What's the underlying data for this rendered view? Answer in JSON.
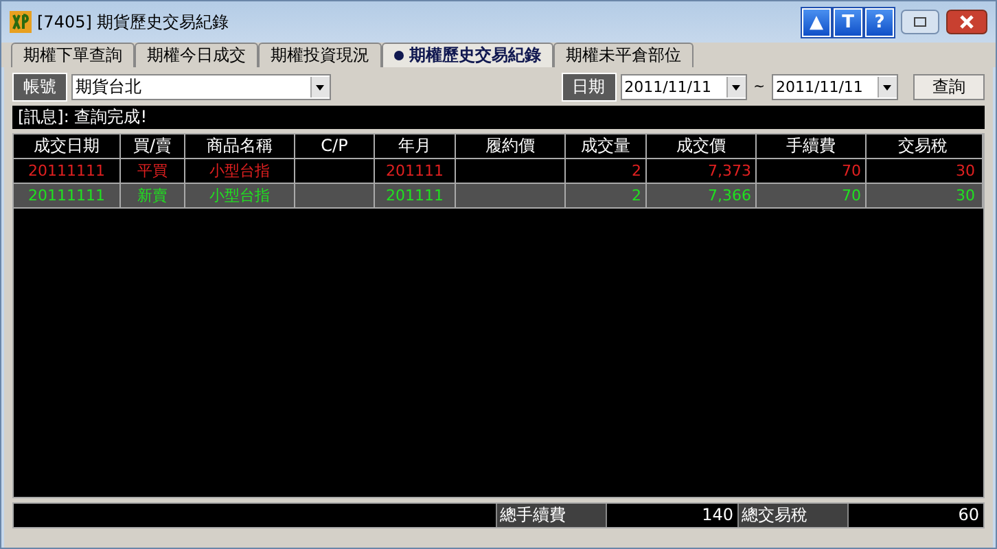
{
  "window": {
    "title": "[7405] 期貨歷史交易紀錄",
    "tool_buttons": [
      "▲",
      "T",
      "?"
    ]
  },
  "tabs": [
    {
      "label": "期權下單查詢",
      "selected": false
    },
    {
      "label": "期權今日成交",
      "selected": false
    },
    {
      "label": "期權投資現況",
      "selected": false
    },
    {
      "label": "期權歷史交易紀錄",
      "selected": true
    },
    {
      "label": "期權未平倉部位",
      "selected": false
    }
  ],
  "toolbar": {
    "account_label": "帳號",
    "account": "期貨台北",
    "date_label": "日期",
    "date_from": "2011/11/11",
    "separator": "~",
    "date_to": "2011/11/11",
    "query_button": "查詢"
  },
  "message": "[訊息]: 查詢完成!",
  "table": {
    "columns": [
      "成交日期",
      "買/賣",
      "商品名稱",
      "C/P",
      "年月",
      "履約價",
      "成交量",
      "成交價",
      "手續費",
      "交易稅"
    ],
    "rows": [
      {
        "selected": false,
        "color": "#e02020",
        "cells": [
          "20111111",
          "平買",
          "小型台指",
          "",
          "201111",
          "",
          "2",
          "7,373",
          "70",
          "30"
        ]
      },
      {
        "selected": true,
        "color": "#20e020",
        "cells": [
          "20111111",
          "新賣",
          "小型台指",
          "",
          "201111",
          "",
          "2",
          "7,366",
          "70",
          "30"
        ]
      }
    ]
  },
  "summary": {
    "fee_label": "總手續費",
    "fee": "140",
    "tax_label": "總交易稅",
    "tax": "60"
  }
}
